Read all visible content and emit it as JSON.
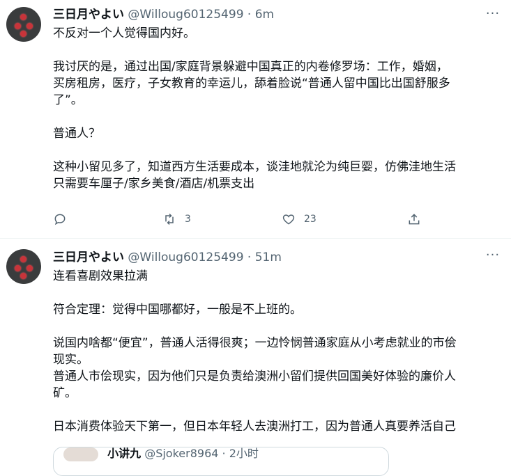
{
  "tweets": [
    {
      "author_name": "三日月やよい",
      "handle": "@Willoug60125499",
      "separator": "·",
      "time": "6m",
      "more_icon": "···",
      "text": "不反对一个人觉得国内好。\n\n我讨厌的是，通过出国/家庭背景躲避中国真正的内卷修罗场：工作，婚姻，\n买房租房，医疗，子女教育的幸运儿，舔着脸说“普通人留中国比出国舒服多\n了”。\n\n普通人？\n\n这种小留见多了，知道西方生活要成本，谈洼地就沦为纯巨婴，仿佛洼地生活\n只需要车厘子/家乡美食/酒店/机票支出",
      "retweet_count": "3",
      "like_count": "23"
    },
    {
      "author_name": "三日月やよい",
      "handle": "@Willoug60125499",
      "separator": "·",
      "time": "51m",
      "more_icon": "···",
      "text": "连看喜剧效果拉满\n\n符合定理：觉得中国哪都好，一般是不上班的。\n\n说国内啥都“便宜”，普通人活得很爽；一边怜悯普通家庭从小考虑就业的市侩\n现实。\n普通人市侩现实，因为他们只是负责给澳洲小留们提供回国美好体验的廉价人\n矿。\n\n日本消费体验天下第一，但日本年轻人去澳洲打工，因为普通人真要养活自己",
      "quote": {
        "name": "小讲九",
        "handle": "@Sjoker8964",
        "separator": "·",
        "time": "2小时"
      }
    }
  ],
  "colors": {
    "text": "#0f1419",
    "secondary": "#536471",
    "border": "#eff3f4"
  },
  "icons": [
    "reply-icon",
    "retweet-icon",
    "like-icon",
    "share-icon",
    "more-icon"
  ]
}
